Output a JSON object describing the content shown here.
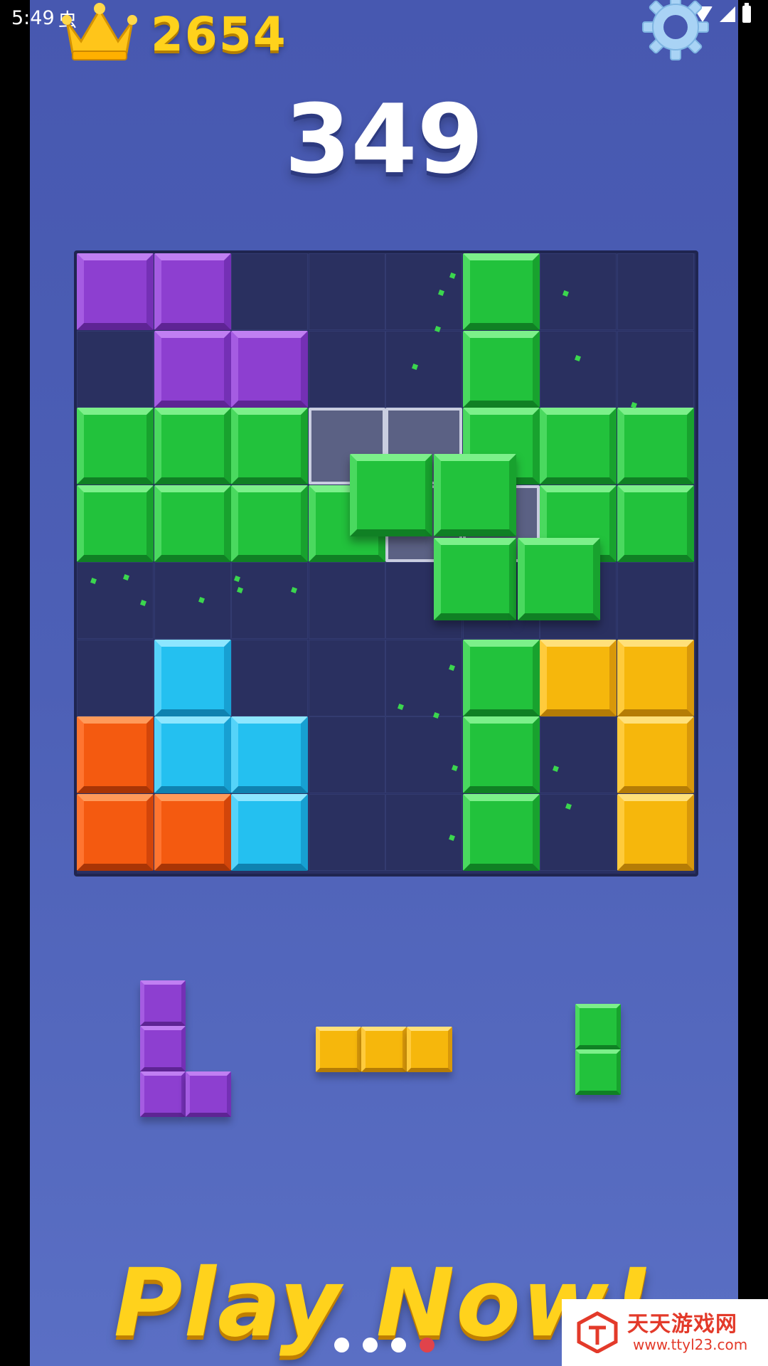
{
  "status_bar": {
    "time": "5:49",
    "debug_icon": "bug-icon",
    "icons": [
      "wifi-icon",
      "signal-icon",
      "battery-icon"
    ]
  },
  "header": {
    "best_score": "2654",
    "best_icon": "crown-icon",
    "settings_icon": "gear-icon"
  },
  "score": "349",
  "board": {
    "rows": 8,
    "cols": 8,
    "cells": [
      "P P . . . G . .",
      ". P P . . G . .",
      "G G G X X G G G",
      "G G G G X X G G",
      ". . . . . . . .",
      ". C . . . G Y Y",
      "O C C . . G . Y",
      "O O C . . G . Y"
    ],
    "colors": {
      "P": "#8d3fd0",
      "G": "#22c23c",
      "C": "#24c0f0",
      "O": "#f45a10",
      "Y": "#f6b70c"
    }
  },
  "tray": {
    "pieces": [
      {
        "name": "purple-L-piece",
        "color": "purple",
        "shape": [
          "X.",
          "X.",
          "XX"
        ]
      },
      {
        "name": "yellow-I3-piece",
        "color": "yellow",
        "shape": [
          "XXX"
        ]
      },
      {
        "name": "green-I2-piece",
        "color": "green",
        "shape": [
          "X",
          "X"
        ]
      }
    ]
  },
  "promo_text": "Play Now!",
  "pager": {
    "count": 4,
    "active": 3
  },
  "watermark": {
    "title": "天天游戏网",
    "url": "www.ttyl23.com"
  }
}
